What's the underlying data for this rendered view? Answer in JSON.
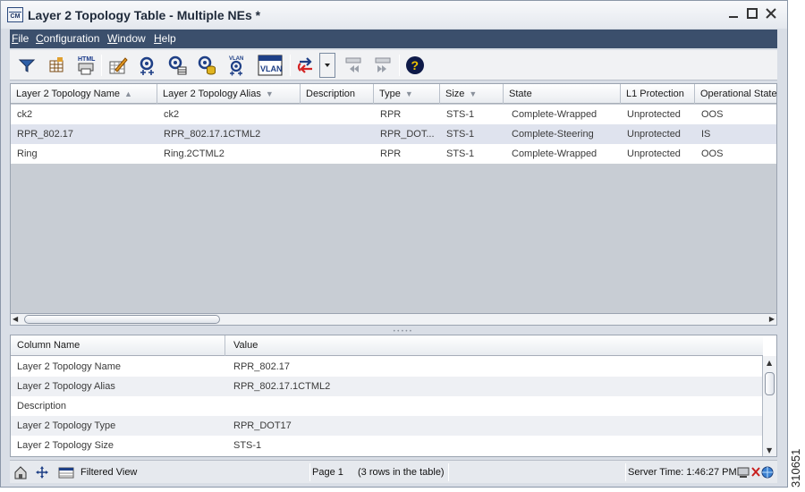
{
  "window": {
    "title": "Layer 2 Topology Table - Multiple NEs *",
    "app_icon_label": "CM"
  },
  "menu": [
    {
      "label": "File",
      "mnemonic": "F",
      "rest": "ile"
    },
    {
      "label": "Configuration",
      "mnemonic": "C",
      "rest": "onfiguration"
    },
    {
      "label": "Window",
      "mnemonic": "W",
      "rest": "indow"
    },
    {
      "label": "Help",
      "mnemonic": "H",
      "rest": "elp"
    }
  ],
  "toolbar": {
    "html_label": "HTML",
    "vlan_label": "VLAN",
    "vlan_small_label": "VLAN",
    "help_label": "?"
  },
  "topology_table": {
    "columns": [
      {
        "label": "Layer 2 Topology Name",
        "sort": "▲"
      },
      {
        "label": "Layer 2 Topology Alias",
        "sort": "▼"
      },
      {
        "label": "Description",
        "sort": ""
      },
      {
        "label": "Type",
        "sort": "▼"
      },
      {
        "label": "Size",
        "sort": "▼"
      },
      {
        "label": "State",
        "sort": ""
      },
      {
        "label": "L1 Protection",
        "sort": ""
      },
      {
        "label": "Operational State",
        "sort": ""
      }
    ],
    "rows": [
      {
        "name": "ck2",
        "alias": "ck2",
        "description": "",
        "type": "RPR",
        "size": "STS-1",
        "state": "Complete-Wrapped",
        "l1_protection": "Unprotected",
        "op_state": "OOS",
        "selected": false
      },
      {
        "name": "RPR_802.17",
        "alias": "RPR_802.17.1CTML2",
        "description": "",
        "type": "RPR_DOT...",
        "size": "STS-1",
        "state": "Complete-Steering",
        "l1_protection": "Unprotected",
        "op_state": "IS",
        "selected": true
      },
      {
        "name": "Ring",
        "alias": "Ring.2CTML2",
        "description": "",
        "type": "RPR",
        "size": "STS-1",
        "state": "Complete-Wrapped",
        "l1_protection": "Unprotected",
        "op_state": "OOS",
        "selected": false
      }
    ]
  },
  "details_table": {
    "columns": [
      "Column Name",
      "Value"
    ],
    "rows": [
      {
        "name": "Layer 2 Topology Name",
        "value": "RPR_802.17"
      },
      {
        "name": "Layer 2 Topology Alias",
        "value": "RPR_802.17.1CTML2"
      },
      {
        "name": "Description",
        "value": ""
      },
      {
        "name": "Layer 2 Topology Type",
        "value": "RPR_DOT17"
      },
      {
        "name": "Layer 2 Topology Size",
        "value": "STS-1"
      }
    ]
  },
  "status": {
    "filter": "Filtered View",
    "page": "Page 1",
    "rows": "(3  rows in the table)",
    "server_time": "Server Time: 1:46:27 PM"
  },
  "figure_number": "310651",
  "colors": {
    "menubar": "#3b4f6c",
    "selected_row": "#dfe3ee",
    "grid_background": "#c8cdd4"
  }
}
